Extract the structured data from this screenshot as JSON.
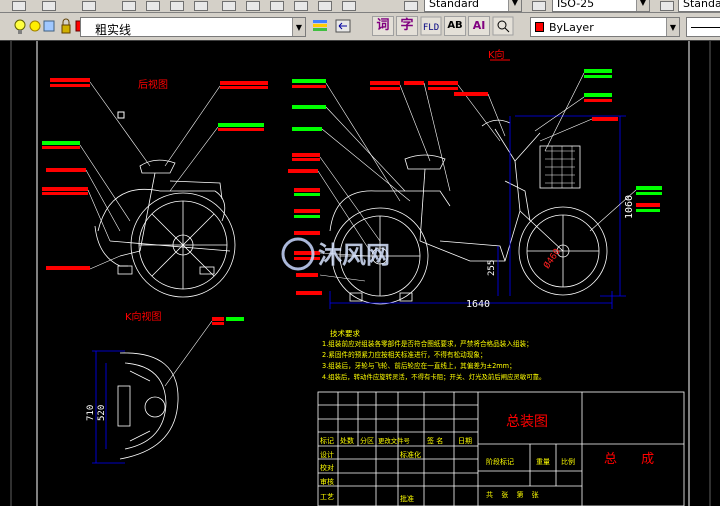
{
  "toolbar_top": {
    "text_style": "Standard",
    "dim_style": "ISO-25",
    "table_style": "Standard"
  },
  "layer_toolbar": {
    "current_layer": "粗实线",
    "color_swatch": "#ff0000"
  },
  "text_toolbar": {
    "btn_ci": "词",
    "btn_zi": "字",
    "btn_ab": "AB",
    "btn_ai": "AI"
  },
  "properties": {
    "color_control": "ByLayer"
  },
  "drawing": {
    "view_side_title": "后视图",
    "view_k_title": "K向",
    "view_k_local_title": "K向视图",
    "dim_length": "1640",
    "dim_height": "1060",
    "dim_small_a": "520",
    "dim_small_b": "710",
    "dim_small_c": "255",
    "dim_wheel": "Ø460",
    "tech_title": "技术要求",
    "tech_lines": [
      "1.组装前应对组装各零部件是否符合图纸要求，严禁将合格品装入组装；",
      "2.紧固件的预紧力应按相关标准进行，不得有松动现象；",
      "3.组装后，牙轮与飞轮、前后轮应在一直线上，其偏差为±2mm；",
      "4.组装后，转动件应旋转灵活，不得有卡阻；开关、灯光及前后闸应灵敏可靠。"
    ],
    "watermark": "沐风网"
  },
  "title_block": {
    "drawing_name": "总装图",
    "part_name": "总 成",
    "h_mark": "标记",
    "h_count": "处数",
    "h_zone": "分区",
    "h_doc": "更改文件号",
    "h_sign": "签 名",
    "h_date": "日期",
    "h_design": "设计",
    "h_std": "标准化",
    "h_check": "校对",
    "h_review": "审核",
    "h_process": "工艺",
    "h_approve": "批准",
    "h_stage": "阶段标记",
    "h_weight": "重量",
    "h_scale": "比例",
    "h_sheets": "共 张 第 张"
  },
  "colors": {
    "background": "#000000",
    "frame": "#ffffff",
    "drawing": "#ffffff",
    "annotation_red": "#ff0000",
    "annotation_green": "#00ff00",
    "dimension_blue": "#0000ff",
    "text_yellow": "#ffff00"
  }
}
